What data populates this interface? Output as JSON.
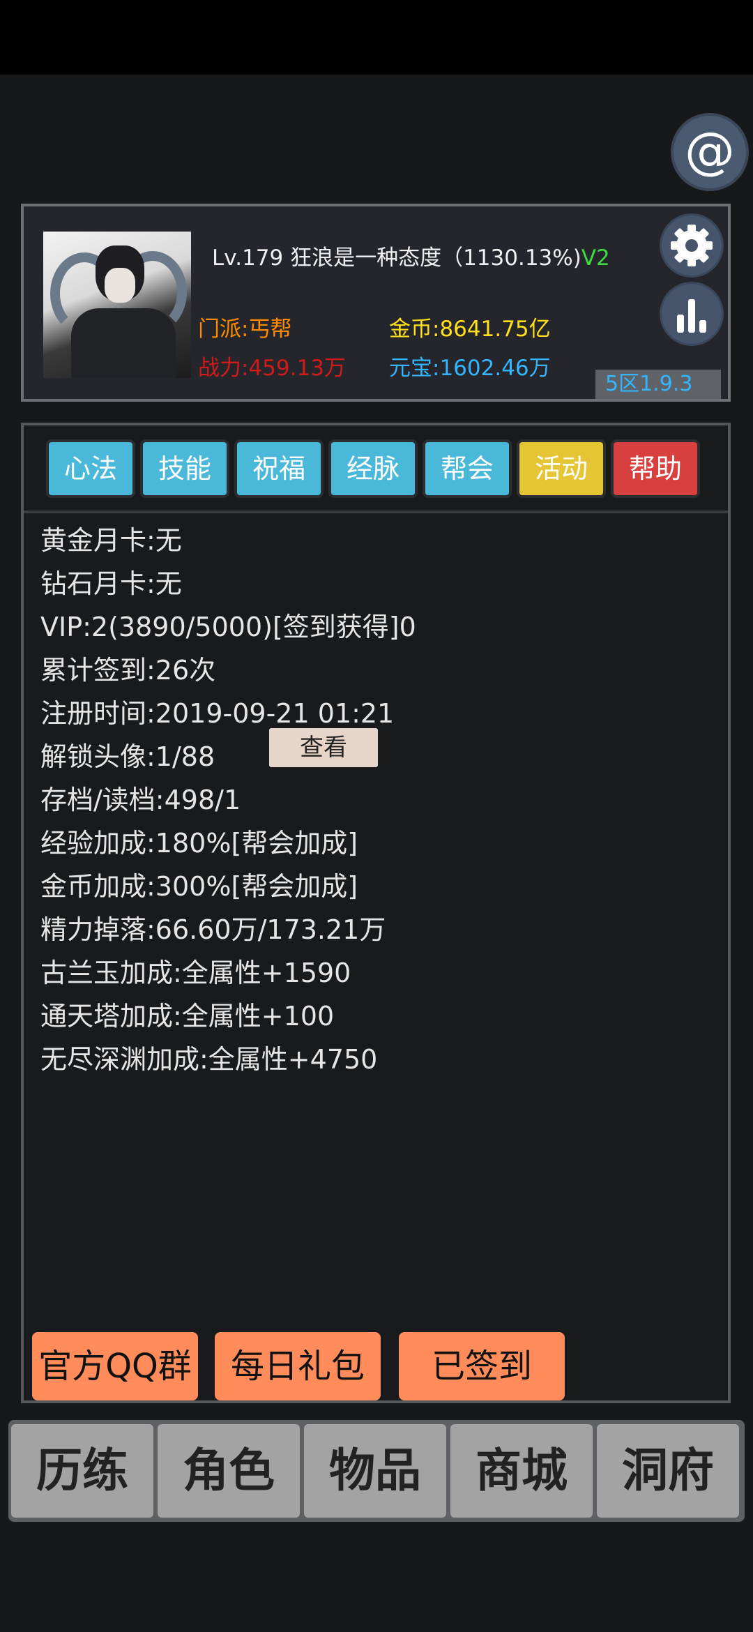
{
  "profile": {
    "level_name": "Lv.179 狂浪是一种态度（1130.13%)",
    "vip_tag": "V2",
    "faction": "门派:丐帮",
    "gold": "金币:8641.75亿",
    "power": "战力:459.13万",
    "yuanbao": "元宝:1602.46万",
    "zone": "5区1.9.3"
  },
  "icons": {
    "settings": "gear-icon",
    "ranking": "bar-chart-icon",
    "float": "at-icon",
    "float_glyph": "@"
  },
  "tabs": [
    {
      "label": "心法",
      "color": "#4ab8d8"
    },
    {
      "label": "技能",
      "color": "#4ab8d8"
    },
    {
      "label": "祝福",
      "color": "#4ab8d8"
    },
    {
      "label": "经脉",
      "color": "#4ab8d8"
    },
    {
      "label": "帮会",
      "color": "#4ab8d8"
    },
    {
      "label": "活动",
      "color": "#e6c534"
    },
    {
      "label": "帮助",
      "color": "#d84040"
    }
  ],
  "info": [
    "黄金月卡:无",
    "钻石月卡:无",
    "VIP:2(3890/5000)[签到获得]0",
    "累计签到:26次",
    "注册时间:2019-09-21 01:21",
    "解锁头像:1/88",
    "存档/读档:498/1",
    "经验加成:180%[帮会加成]",
    "金币加成:300%[帮会加成]",
    "精力掉落:66.60万/173.21万",
    "古兰玉加成:全属性+1590",
    "通天塔加成:全属性+100",
    "无尽深渊加成:全属性+4750"
  ],
  "view_button": "查看",
  "actions": {
    "qq_group": "官方QQ群",
    "daily_gift": "每日礼包",
    "signed": "已签到"
  },
  "nav": [
    "历练",
    "角色",
    "物品",
    "商城",
    "洞府"
  ]
}
